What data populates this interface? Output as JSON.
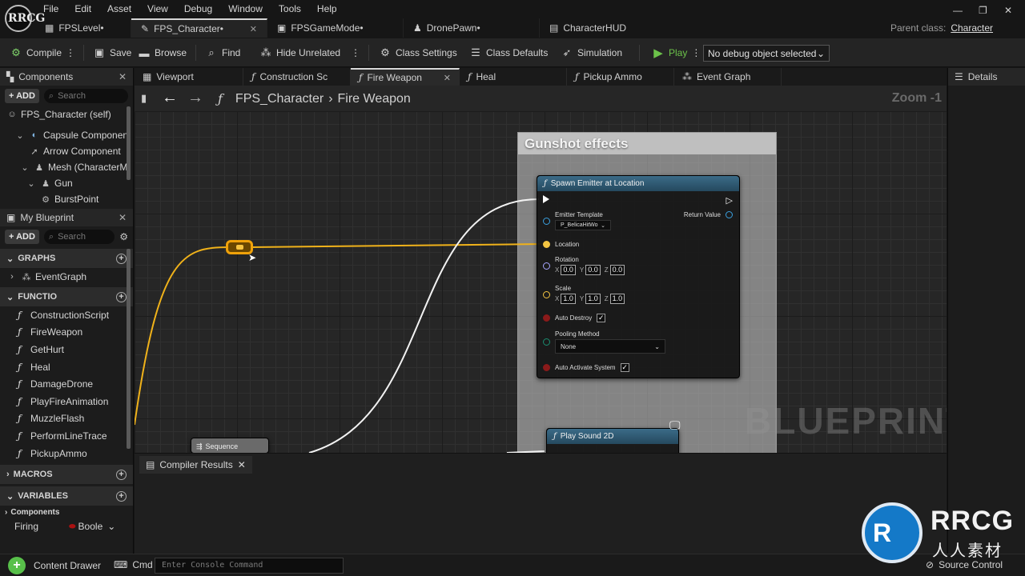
{
  "app": {
    "menu": [
      "File",
      "Edit",
      "Asset",
      "View",
      "Debug",
      "Window",
      "Tools",
      "Help"
    ],
    "tabs": [
      {
        "label": "FPSLevel•",
        "icon": "level-icon"
      },
      {
        "label": "FPS_Character•",
        "icon": "blueprint-icon",
        "active": true
      },
      {
        "label": "FPSGameMode•",
        "icon": "blueprint-icon"
      },
      {
        "label": "DronePawn•",
        "icon": "pawn-icon"
      },
      {
        "label": "CharacterHUD",
        "icon": "widget-icon"
      }
    ],
    "parent_class_label": "Parent class:",
    "parent_class_value": "Character",
    "logo_text": "RRCG"
  },
  "toolbar": {
    "compile": "Compile",
    "save": "Save",
    "browse": "Browse",
    "find": "Find",
    "hide_unrelated": "Hide Unrelated",
    "class_settings": "Class Settings",
    "class_defaults": "Class Defaults",
    "simulation": "Simulation",
    "play": "Play",
    "debug_object": "No debug object selected"
  },
  "components": {
    "title": "Components",
    "add": "+ ADD",
    "search_placeholder": "Search",
    "items": [
      {
        "label": "FPS_Character (self)",
        "indent": 0
      },
      {
        "label": "Capsule Componen",
        "indent": 1
      },
      {
        "label": "Arrow Component",
        "indent": 2
      },
      {
        "label": "Mesh (CharacterM",
        "indent": 2
      },
      {
        "label": "Gun",
        "indent": 3
      },
      {
        "label": "BurstPoint",
        "indent": 4
      }
    ]
  },
  "my_blueprint": {
    "title": "My Blueprint",
    "add": "+ ADD",
    "search_placeholder": "Search",
    "graphs_header": "GRAPHS",
    "graphs": [
      "EventGraph"
    ],
    "functions_header": "FUNCTIO",
    "functions": [
      "ConstructionScript",
      "FireWeapon",
      "GetHurt",
      "Heal",
      "DamageDrone",
      "PlayFireAnimation",
      "MuzzleFlash",
      "PerformLineTrace",
      "PickupAmmo"
    ],
    "macros_header": "MACROS",
    "variables_header": "VARIABLES",
    "variables_sub": "Components",
    "variable_row": {
      "name": "Firing",
      "type": "Boole"
    }
  },
  "graph_tabs": [
    {
      "label": "Viewport",
      "icon": "viewport-icon"
    },
    {
      "label": "Construction Sc",
      "icon": "function-icon"
    },
    {
      "label": "Fire Weapon",
      "icon": "function-icon",
      "active": true
    },
    {
      "label": "Heal",
      "icon": "function-icon"
    },
    {
      "label": "Pickup Ammo",
      "icon": "function-icon"
    },
    {
      "label": "Event Graph",
      "icon": "graph-icon"
    }
  ],
  "graph": {
    "breadcrumb_root": "FPS_Character",
    "breadcrumb_leaf": "Fire Weapon",
    "zoom": "Zoom -1",
    "comment": "Gunshot effects",
    "watermark": "BLUEPRINT",
    "spawn_node": {
      "title": "Spawn Emitter at Location",
      "emitter_template": "Emitter Template",
      "emitter_value": "P_BelicaHitWo",
      "return_value": "Return Value",
      "location": "Location",
      "rotation": "Rotation",
      "rotation_values": [
        "0.0",
        "0.0",
        "0.0"
      ],
      "scale": "Scale",
      "scale_values": [
        "1.0",
        "1.0",
        "1.0"
      ],
      "auto_destroy": "Auto Destroy",
      "pooling_method": "Pooling Method",
      "pooling_value": "None",
      "auto_activate": "Auto Activate System"
    },
    "sound_node": {
      "title": "Play Sound 2D"
    },
    "sequence_node": {
      "title": "Sequence"
    },
    "colors": {
      "exec": "#ffffff",
      "vector": "#f4c542",
      "object": "#3aa0e0",
      "rotator": "#a7a7ff",
      "bool": "#8b1a1a"
    }
  },
  "compiler": {
    "tab": "Compiler Results"
  },
  "details": {
    "title": "Details"
  },
  "statusbar": {
    "content_drawer": "Content Drawer",
    "cmd": "Cmd",
    "console_placeholder": "Enter Console Command",
    "source_control": "Source Control"
  },
  "brand": {
    "name": "RRCG",
    "sub": "人人素材"
  }
}
